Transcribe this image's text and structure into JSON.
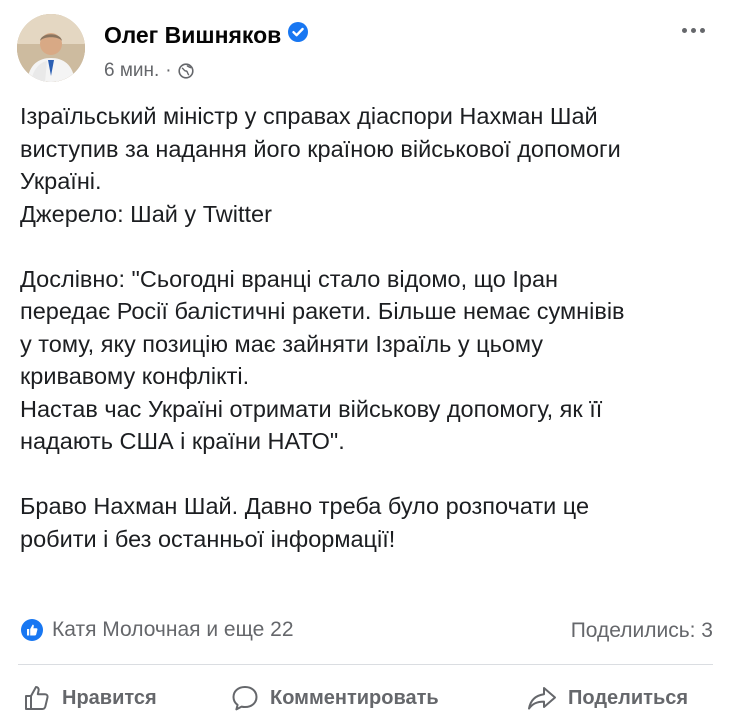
{
  "post": {
    "author": "Олег Вишняков",
    "time": "6 мин.",
    "separator": "·",
    "icons": {
      "verified": "verified-badge-icon",
      "audience": "globe-icon",
      "more": "more-options-icon"
    },
    "colors": {
      "verified": "#1877f2",
      "like": "#1877f2",
      "muted": "#65676b"
    },
    "paragraphs": [
      "Ізраїльський міністр у справах діаспори Нахман Шай",
      "виступив за надання його країною військової допомоги",
      "Україні.",
      "Джерело: Шай у Twitter",
      "",
      "Дослівно: \"Сьогодні вранці стало відомо, що Іран",
      "передає Росії балістичні ракети. Більше немає сумнівів",
      "у тому, яку позицію має зайняти Ізраїль у цьому",
      "кривавому конфлікті.",
      "Настав час Україні отримати військову допомогу, як її",
      "надають США і країни НАТО\".",
      "",
      "Браво Нахман Шай.  Давно треба було розпочати це",
      "робити і без останньої інформації!"
    ],
    "reactions": {
      "icon": "like-reaction-icon",
      "text": "Катя Молочная и еще 22"
    },
    "shares": "Поделились: 3",
    "actions": {
      "like": {
        "label": "Нравится",
        "icon": "thumbs-up-icon"
      },
      "comment": {
        "label": "Комментировать",
        "icon": "comment-bubble-icon"
      },
      "share": {
        "label": "Поделиться",
        "icon": "share-arrow-icon"
      }
    }
  }
}
